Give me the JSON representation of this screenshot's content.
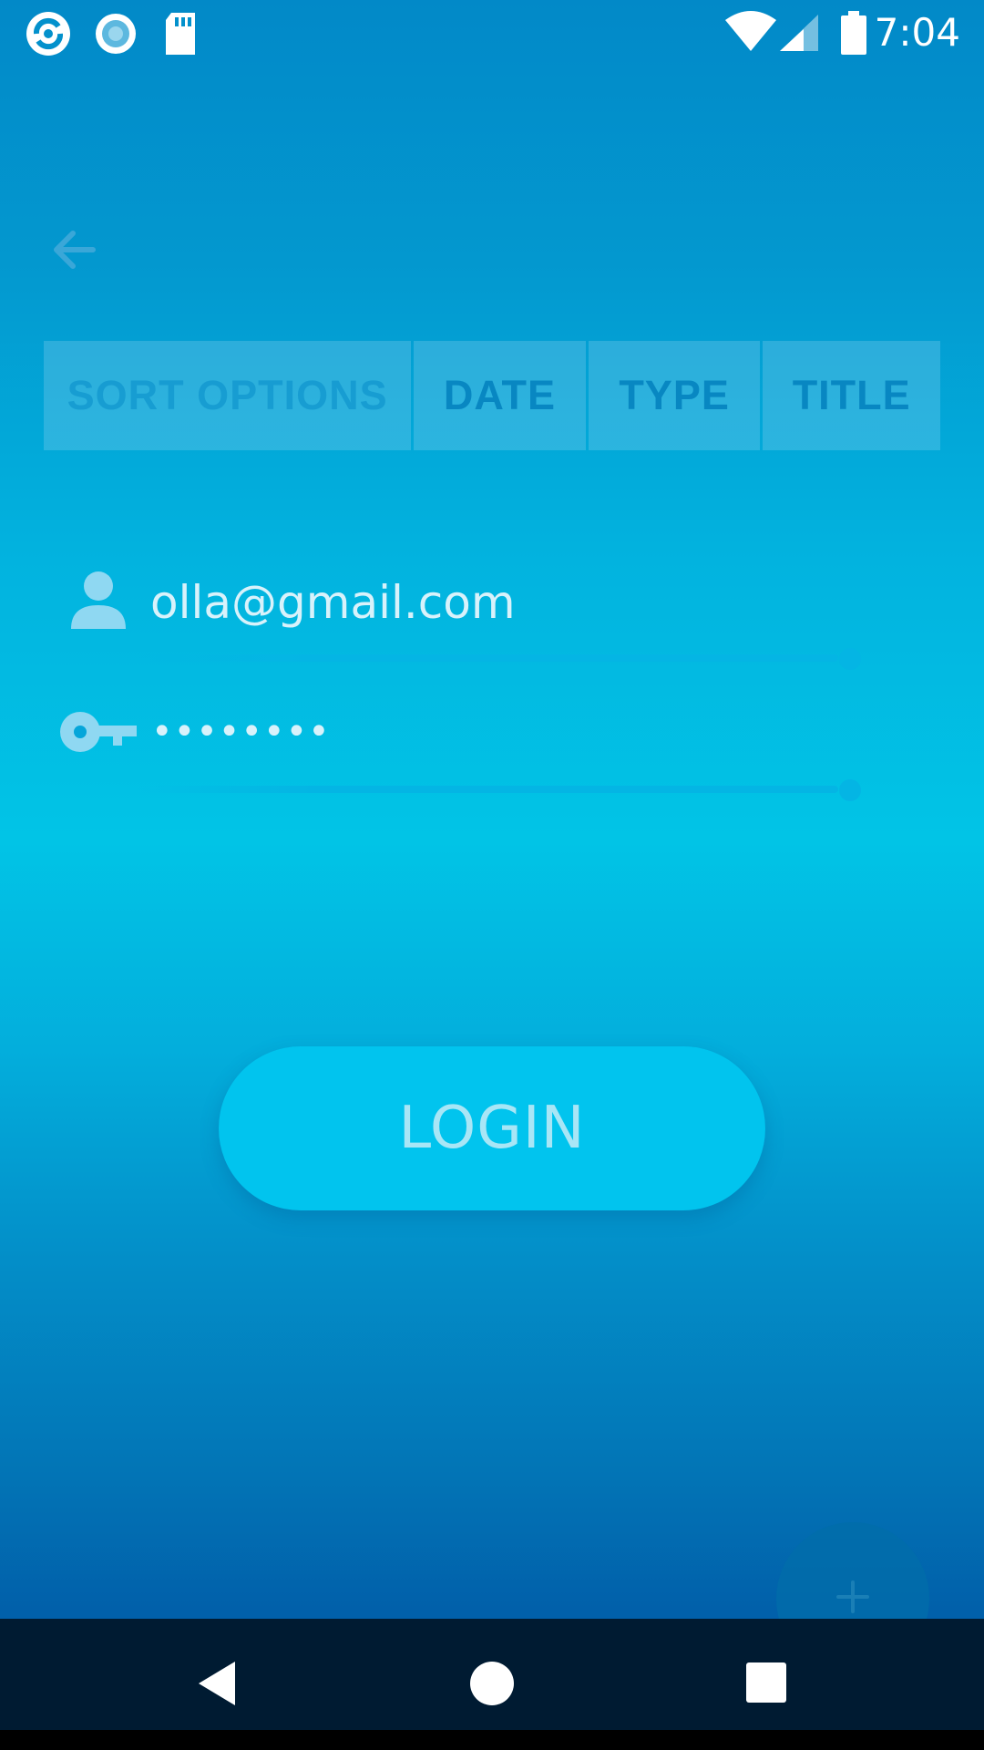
{
  "status_bar": {
    "time": "7:04",
    "icons": [
      "app-notification-icon",
      "record-icon",
      "sd-card-icon",
      "wifi-icon",
      "cell-signal-icon",
      "battery-icon"
    ]
  },
  "toolbar": {
    "back_icon": "arrow-back-icon"
  },
  "sort_bar": {
    "title": "SORT OPTIONS",
    "options": [
      "DATE",
      "TYPE",
      "TITLE"
    ]
  },
  "form": {
    "email": {
      "icon": "person-icon",
      "value": "olla@gmail.com"
    },
    "password": {
      "icon": "key-icon",
      "value": "••••••••"
    },
    "login_label": "LOGIN"
  },
  "fab": {
    "icon": "plus-icon",
    "label": "+"
  },
  "nav_bar": {
    "buttons": [
      "back-nav-icon",
      "home-nav-icon",
      "recents-nav-icon"
    ]
  },
  "colors": {
    "accent": "#01c4ee",
    "sort_bar_bg": "#4bb5de",
    "nav_bar_bg": "#001b32"
  }
}
